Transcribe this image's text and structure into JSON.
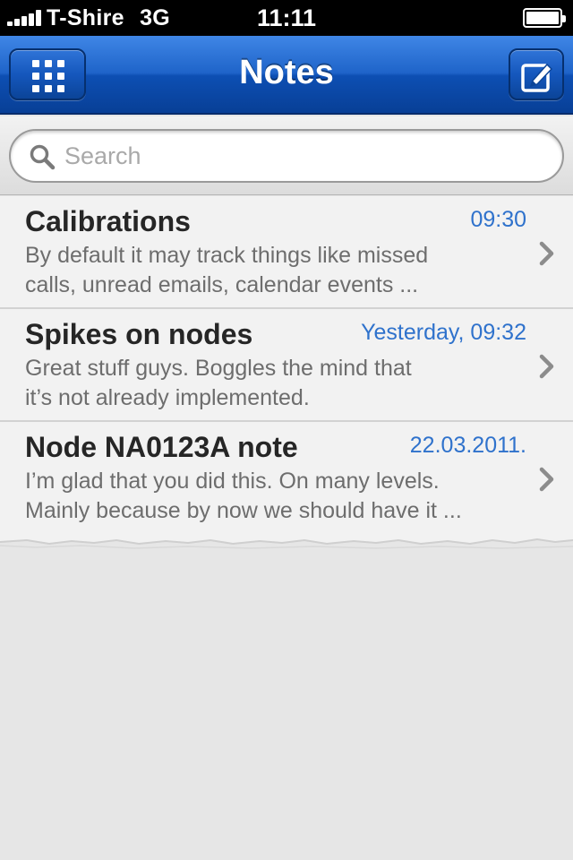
{
  "status_bar": {
    "carrier": "T-Shire",
    "network": "3G",
    "time": "11:11",
    "signal_icon": "signal-bars-icon",
    "battery_icon": "battery-icon"
  },
  "nav": {
    "title": "Notes",
    "left_icon": "grid-menu-icon",
    "right_icon": "compose-icon",
    "accent_color": "#1f64c9"
  },
  "search": {
    "placeholder": "Search",
    "value": ""
  },
  "notes": [
    {
      "title": "Calibrations",
      "date": "09:30",
      "preview_line1": "By default it may track things like missed",
      "preview_line2": "calls, unread emails, calendar events ..."
    },
    {
      "title": "Spikes on nodes",
      "date": "Yesterday, 09:32",
      "preview_line1": "Great stuff guys. Boggles the mind that",
      "preview_line2": "it’s not already implemented."
    },
    {
      "title": "Node NA0123A note",
      "date": "22.03.2011.",
      "preview_line1": "I’m glad that you did this. On many levels.",
      "preview_line2": "Mainly because by now we should have it ..."
    }
  ],
  "colors": {
    "date_text": "#2f72cc",
    "title_text": "#262626",
    "preview_text": "#6d6d6d",
    "row_background": "#f2f2f2"
  }
}
